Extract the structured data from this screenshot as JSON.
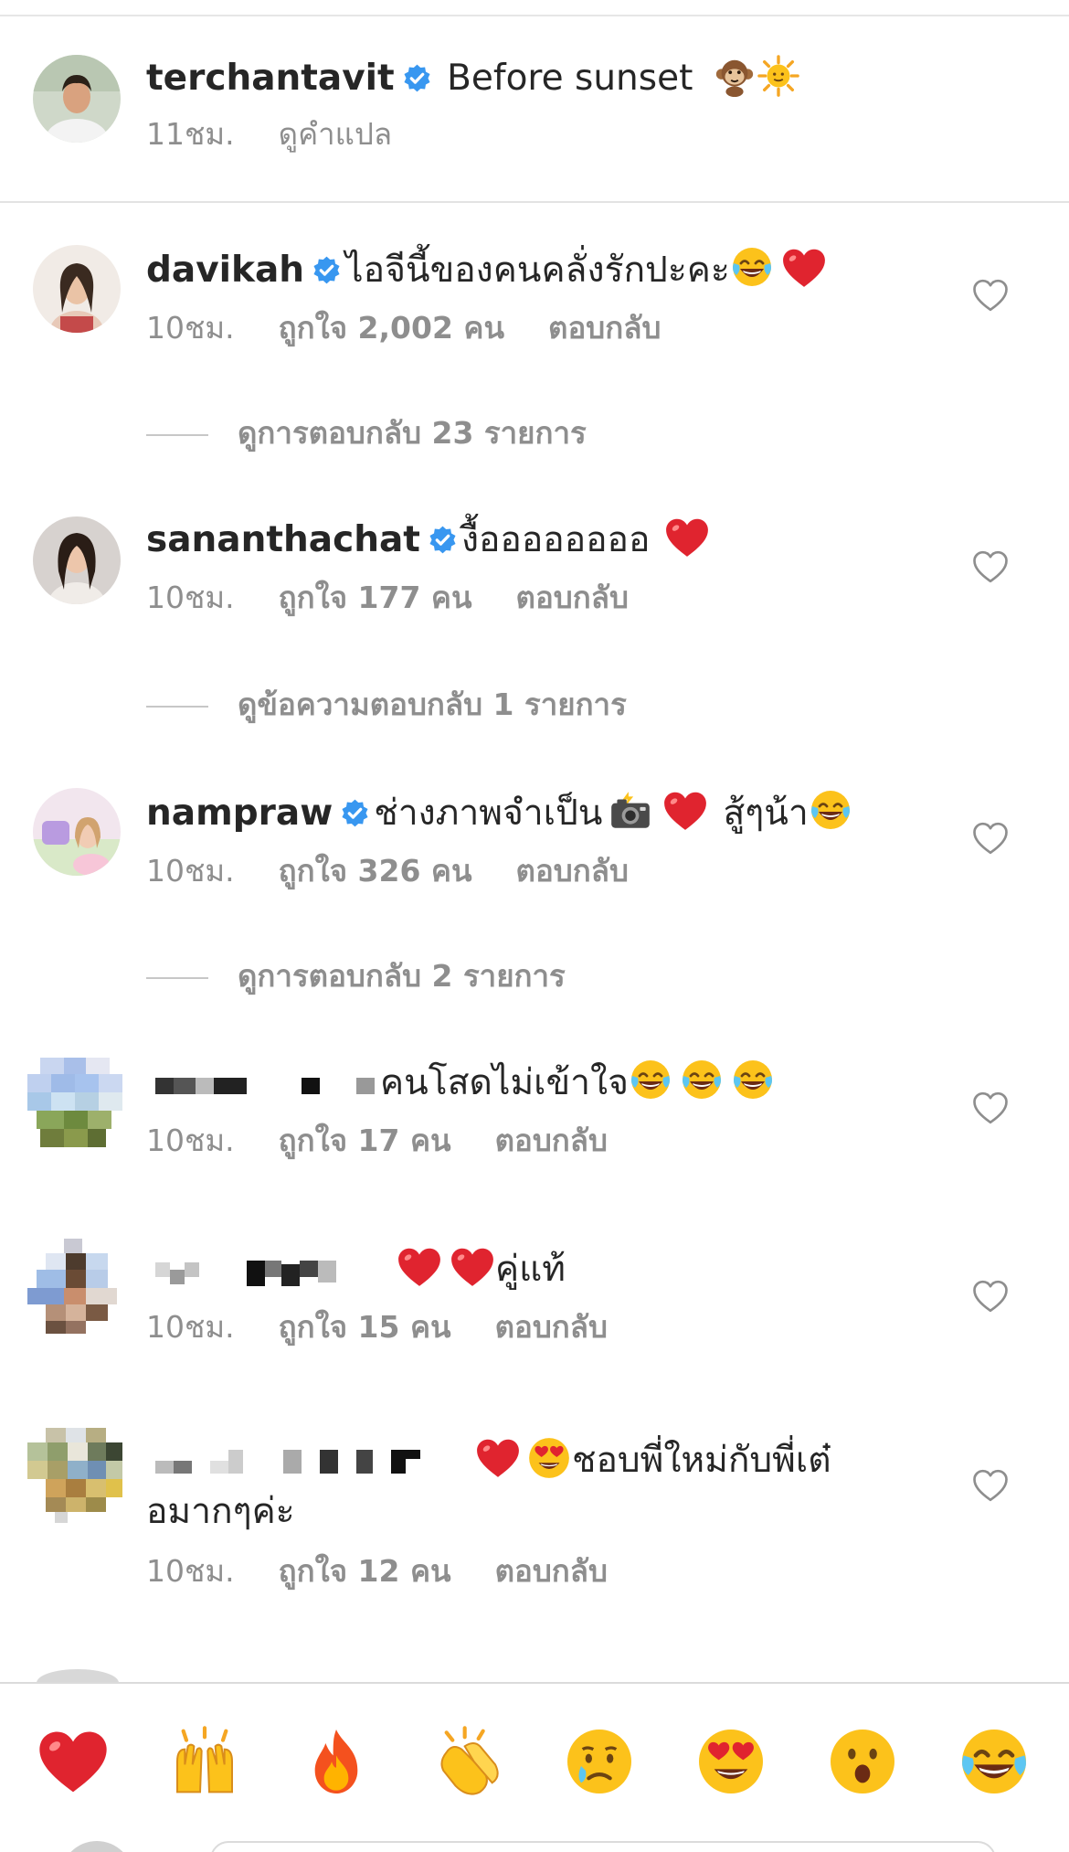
{
  "caption": {
    "username": "terchantavit",
    "text": "Before sunset",
    "emojis": [
      "monkey",
      "sun"
    ],
    "time": "11ชม.",
    "translate_label": "ดูคำแปล"
  },
  "comments": [
    {
      "username": "davikah",
      "verified": true,
      "text": "ไอจีนี้ของคนคลั่งรักปะคะ",
      "emojis": [
        "laughing-tears",
        "red-heart"
      ],
      "time": "10ชม.",
      "likes": "ถูกใจ 2,002 คน",
      "reply_label": "ตอบกลับ",
      "view_replies": "ดูการตอบกลับ 23 รายการ"
    },
    {
      "username": "sananthachat",
      "verified": true,
      "text": "งื้ออออออออ",
      "emojis": [
        "red-heart"
      ],
      "time": "10ชม.",
      "likes": "ถูกใจ 177 คน",
      "reply_label": "ตอบกลับ",
      "view_replies": "ดูข้อความตอบกลับ 1 รายการ"
    },
    {
      "username": "nampraw",
      "verified": true,
      "text": "ช่างภาพจำเป็น",
      "text2": "สู้ๆน้า",
      "emojis": [
        "camera-flash",
        "red-heart",
        "laughing-tears"
      ],
      "time": "10ชม.",
      "likes": "ถูกใจ 326 คน",
      "reply_label": "ตอบกลับ",
      "view_replies": "ดูการตอบกลับ 2 รายการ"
    },
    {
      "username": "",
      "verified": false,
      "text": "คนโสดไม่เข้าใจ",
      "emojis": [
        "laughing-tears",
        "laughing-tears",
        "laughing-tears"
      ],
      "time": "10ชม.",
      "likes": "ถูกใจ 17 คน",
      "reply_label": "ตอบกลับ"
    },
    {
      "username": "",
      "verified": false,
      "text": "คู่แท้",
      "emojis": [
        "red-heart",
        "red-heart"
      ],
      "time": "10ชม.",
      "likes": "ถูกใจ 15 คน",
      "reply_label": "ตอบกลับ"
    },
    {
      "username": "",
      "verified": false,
      "text": "ชอบพี่ใหม่กับพี่เต๋",
      "text_cont": "อมากๆค่ะ",
      "emojis": [
        "red-heart",
        "heart-eyes"
      ],
      "time": "10ชม.",
      "likes": "ถูกใจ 12 คน",
      "reply_label": "ตอบกลับ"
    }
  ],
  "emoji_bar": [
    "red-heart",
    "raising-hands",
    "fire",
    "clapping-hands",
    "crying-face",
    "heart-eyes",
    "surprised-face",
    "laughing-tears"
  ],
  "colors": {
    "verified_blue": "#3897f0",
    "meta_gray": "#8e8e8e",
    "heart_red": "#e0242f",
    "divider": "#dbdbdb"
  }
}
